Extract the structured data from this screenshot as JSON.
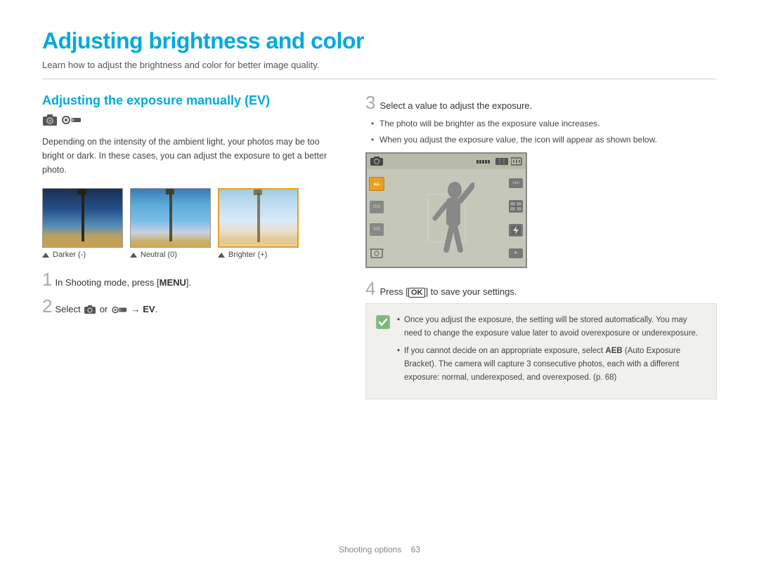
{
  "page": {
    "title": "Adjusting brightness and color",
    "subtitle": "Learn how to adjust the brightness and color for better image quality."
  },
  "left_section": {
    "heading": "Adjusting the exposure manually (EV)",
    "body_text": "Depending on the intensity of the ambient light, your photos may be too bright or dark. In these cases, you can adjust the exposure to get a better photo.",
    "photos": [
      {
        "caption": "Darker (-)",
        "tone": "darker"
      },
      {
        "caption": "Neutral (0)",
        "tone": "neutral"
      },
      {
        "caption": "Brighter (+)",
        "tone": "brighter"
      }
    ],
    "step1": {
      "number": "1",
      "text": "In Shooting mode, press [MENU]."
    },
    "step2": {
      "number": "2",
      "text": "Select  or  → EV."
    }
  },
  "right_section": {
    "step3": {
      "number": "3",
      "text": "Select a value to adjust the exposure."
    },
    "step3_bullets": [
      "The photo will be brighter as the exposure value increases.",
      "When you adjust the exposure value, the icon will appear as shown below."
    ],
    "step4": {
      "number": "4",
      "text": "Press [OK] to save your settings."
    },
    "info_bullets": [
      "Once you adjust the exposure, the setting will be stored automatically. You may need to change the exposure value later to avoid overexposure or underexposure.",
      "If you cannot decide on an appropriate exposure, select AEB (Auto Exposure Bracket). The camera will capture 3 consecutive photos, each with a different exposure: normal, underexposed, and overexposed. (p. 68)"
    ]
  },
  "footer": {
    "label": "Shooting options",
    "page_number": "63"
  }
}
